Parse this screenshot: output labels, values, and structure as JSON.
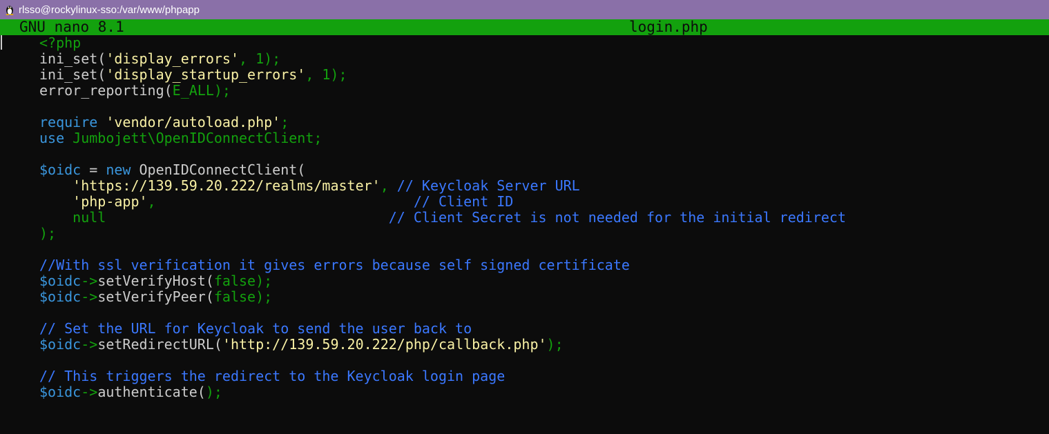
{
  "window": {
    "title": "rlsso@rockylinux-sso:/var/www/phpapp",
    "icon": "tux-penguin-icon"
  },
  "nano": {
    "version": "GNU nano 8.1",
    "filename": "login.php"
  },
  "colors": {
    "titlebar": "#8a70a8",
    "nanobar": "#13a10e",
    "background": "#0c0c0c",
    "text": "#cccccc",
    "keyword": "#3a96dd",
    "string": "#f9f1a5",
    "punctuation": "#13a10e",
    "comment": "#3b78ff"
  },
  "code_lines": [
    [
      [
        "punc",
        "<?php"
      ]
    ],
    [
      [
        "def",
        "ini_set("
      ],
      [
        "str",
        "'display_errors'"
      ],
      [
        "punc",
        ", 1);"
      ]
    ],
    [
      [
        "def",
        "ini_set("
      ],
      [
        "str",
        "'display_startup_errors'"
      ],
      [
        "punc",
        ", 1);"
      ]
    ],
    [
      [
        "def",
        "error_reporting("
      ],
      [
        "punc",
        "E_ALL);"
      ]
    ],
    [],
    [
      [
        "kw",
        "require "
      ],
      [
        "str",
        "'vendor/autoload.php'"
      ],
      [
        "punc",
        ";"
      ]
    ],
    [
      [
        "kw",
        "use "
      ],
      [
        "punc",
        "Jumbojett\\OpenIDConnectClient;"
      ]
    ],
    [],
    [
      [
        "var",
        "$oidc"
      ],
      [
        "def",
        " = "
      ],
      [
        "kw",
        "new "
      ],
      [
        "def",
        "OpenIDConnectClient("
      ]
    ],
    [
      [
        "def",
        "    "
      ],
      [
        "str",
        "'https://139.59.20.222/realms/master'"
      ],
      [
        "punc",
        ", "
      ],
      [
        "cmt",
        "// Keycloak Server URL"
      ]
    ],
    [
      [
        "def",
        "    "
      ],
      [
        "str",
        "'php-app'"
      ],
      [
        "punc",
        ",                               "
      ],
      [
        "cmt",
        "// Client ID"
      ]
    ],
    [
      [
        "def",
        "    "
      ],
      [
        "punc",
        "null                                  "
      ],
      [
        "cmt",
        "// Client Secret is not needed for the initial redirect"
      ]
    ],
    [
      [
        "punc",
        ");"
      ]
    ],
    [],
    [
      [
        "cmt",
        "//With ssl verification it gives errors because self signed certificate"
      ]
    ],
    [
      [
        "var",
        "$oidc"
      ],
      [
        "punc",
        "->"
      ],
      [
        "def",
        "setVerifyHost("
      ],
      [
        "punc",
        "false);"
      ]
    ],
    [
      [
        "var",
        "$oidc"
      ],
      [
        "punc",
        "->"
      ],
      [
        "def",
        "setVerifyPeer("
      ],
      [
        "punc",
        "false);"
      ]
    ],
    [],
    [
      [
        "cmt",
        "// Set the URL for Keycloak to send the user back to"
      ]
    ],
    [
      [
        "var",
        "$oidc"
      ],
      [
        "punc",
        "->"
      ],
      [
        "def",
        "setRedirectURL("
      ],
      [
        "str",
        "'http://139.59.20.222/php/callback.php'"
      ],
      [
        "punc",
        ");"
      ]
    ],
    [],
    [
      [
        "cmt",
        "// This triggers the redirect to the Keycloak login page"
      ]
    ],
    [
      [
        "var",
        "$oidc"
      ],
      [
        "punc",
        "->"
      ],
      [
        "def",
        "authenticate("
      ],
      [
        "punc",
        ");"
      ]
    ]
  ]
}
